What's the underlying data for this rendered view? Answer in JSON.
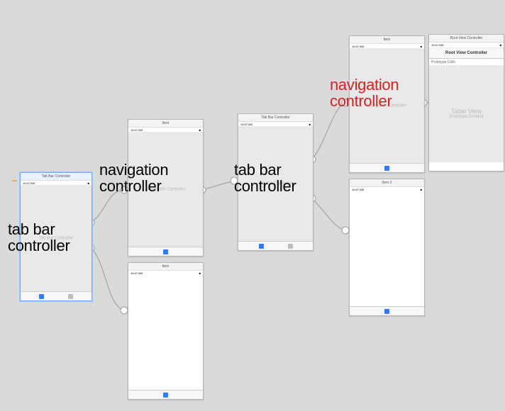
{
  "status": {
    "time": "10:47 AM",
    "battery": "■"
  },
  "scenes": {
    "s1": {
      "title": "Tab Bar Controller",
      "placeholder": "Tab Bar Controller"
    },
    "s2": {
      "title": "Item",
      "placeholder": "Navigation Controller"
    },
    "s3": {
      "title": "Item"
    },
    "s4": {
      "title": "Tab Bar Controller",
      "placeholder": "Tab Bar Controller"
    },
    "s5": {
      "title": "Item",
      "placeholder": "Navigation Controller"
    },
    "s6": {
      "title": "Item 2"
    },
    "s7": {
      "title": "Root View Controller",
      "navTitle": "Root View Controller",
      "proto": "Prototype Cells",
      "ph1": "Table View",
      "ph2": "Prototype Content"
    }
  },
  "labels": {
    "l1": "tab bar\ncontroller",
    "l2": "navigation\ncontroller",
    "l3": "tab bar\ncontroller",
    "l4": "navigation\ncontroller"
  }
}
